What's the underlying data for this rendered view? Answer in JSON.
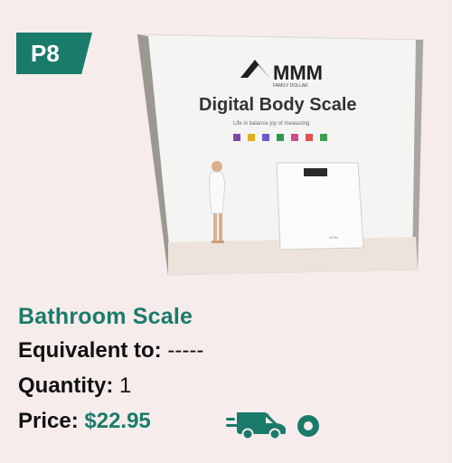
{
  "badge": {
    "code": "P8"
  },
  "product_image": {
    "brand": "MMM",
    "brand_sub": "FAMILY DOLLAR",
    "headline": "Digital Body Scale",
    "tagline": "Life in balance joy of measuring"
  },
  "product": {
    "name": "Bathroom Scale",
    "equivalent_label": "Equivalent to:",
    "equivalent_value": "-----",
    "quantity_label": "Quantity:",
    "quantity_value": "1",
    "price_label": "Price:",
    "price_value": "$22.95"
  },
  "icons": {
    "delivery": "delivery-van-icon",
    "location": "location-circle-icon"
  },
  "colors": {
    "accent": "#1a7b6a",
    "background": "#f6eaea",
    "text": "#111111"
  }
}
